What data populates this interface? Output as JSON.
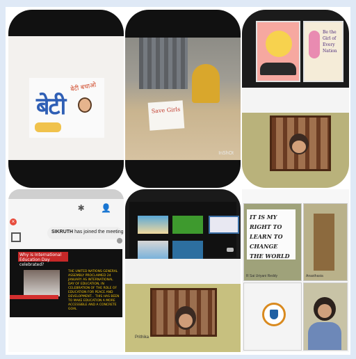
{
  "tile1": {
    "letters": "बेटी",
    "hand_text": "बेटी बचाओ"
  },
  "tile2": {
    "card_text": "Save Girls",
    "watermark": "InShOt"
  },
  "tile3": {
    "poster_text": "Be the Girl of Every Nation"
  },
  "tile4": {
    "notification_name": "SIKRUTH",
    "notification_text": "has joined the meeting",
    "slide_heading": "Why is International Education Day celebrated?",
    "slide_body": "THE UNITED NATIONS GENERAL ASSEMBLY PROCLAIMED 24 JANUARY AS INTERNATIONAL DAY OF EDUCATION, IN CELEBRATION OF THE ROLE OF EDUCATION FOR PEACE AND DEVELOPMENT... THIS HAS BEEN TO MAKE EDUCATION A MORE ACCESSIBLE AND A CONCRETE GOAL",
    "close_icon_glyph": "×"
  },
  "tile5": {
    "participant_name": "Prithika"
  },
  "tile6": {
    "sign_text": "It is my right to learn to change the world",
    "label_1": "R Sai Uriyani Reddy",
    "label_2": "Anasthasia"
  }
}
